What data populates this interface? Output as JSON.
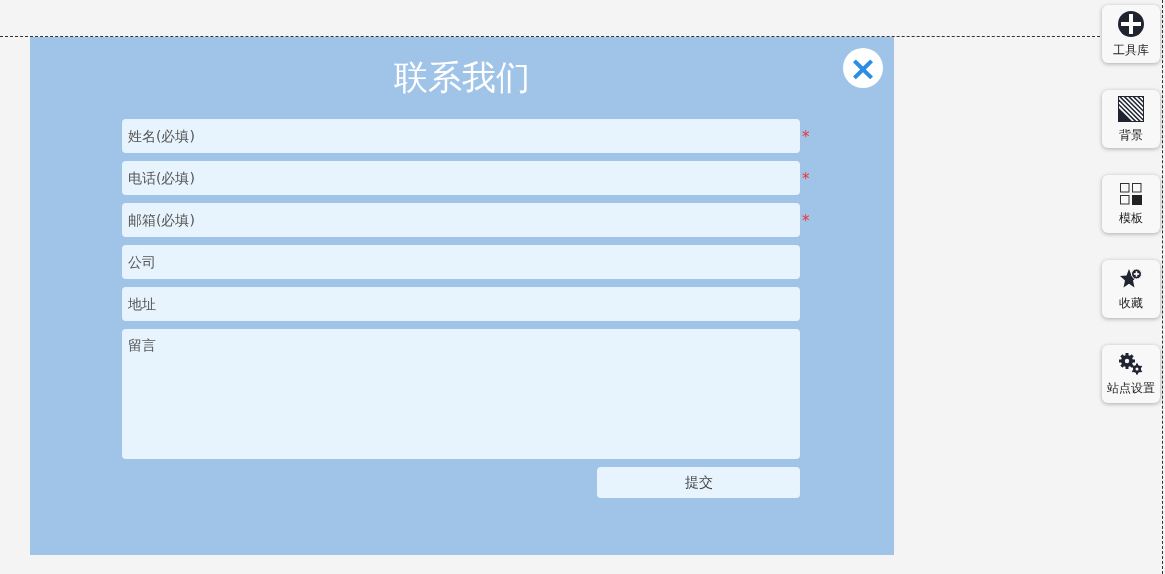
{
  "dialog": {
    "title": "联系我们",
    "close": "×",
    "fields": [
      {
        "kind": "input",
        "placeholder": "姓名(必填)",
        "required": true
      },
      {
        "kind": "input",
        "placeholder": "电话(必填)",
        "required": true
      },
      {
        "kind": "input",
        "placeholder": "邮箱(必填)",
        "required": true
      },
      {
        "kind": "input",
        "placeholder": "公司",
        "required": false
      },
      {
        "kind": "input",
        "placeholder": "地址",
        "required": false
      },
      {
        "kind": "textarea",
        "placeholder": "留言",
        "required": false
      }
    ],
    "required_mark": "*",
    "submit": "提交"
  },
  "toolbar": [
    {
      "kind": "plus",
      "label": "工具库"
    },
    {
      "kind": "stripes",
      "label": "背景"
    },
    {
      "kind": "grid",
      "label": "模板"
    },
    {
      "kind": "star",
      "label": "收藏"
    },
    {
      "kind": "gears",
      "label": "站点设置"
    }
  ]
}
